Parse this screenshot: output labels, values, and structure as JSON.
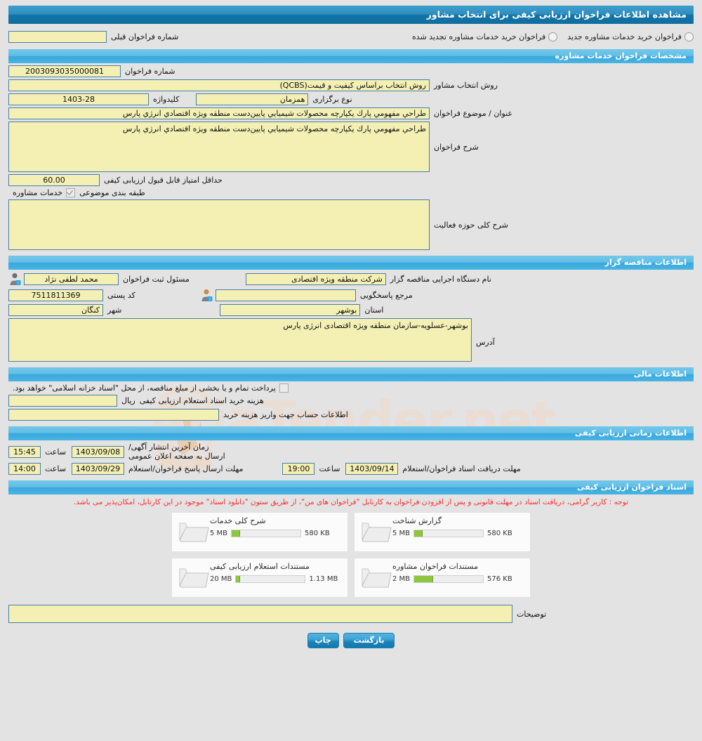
{
  "page": {
    "title": "مشاهده اطلاعات فراخوان ارزیابی کیفی برای انتخاب مشاور"
  },
  "top": {
    "radio_new": "فراخوان خرید خدمات مشاوره جدید",
    "radio_renewed": "فراخوان خرید خدمات مشاوره تجدید شده",
    "prev_call_label": "شماره فراخوان قبلی",
    "prev_call_value": ""
  },
  "sections": {
    "specs": "مشخصات فراخوان خدمات مشاوره",
    "organizer": "اطلاعات مناقصه گزار",
    "financial": "اطلاعات مالی",
    "timing": "اطلاعات زمانی ارزیابی کیفی",
    "documents": "اسناد فراخوان ارزیابی کیفی"
  },
  "specs": {
    "call_number_label": "شماره فراخوان",
    "call_number_value": "2003093035000081",
    "selection_method_label": "روش انتخاب مشاور",
    "selection_method_value": "روش انتخاب براساس کیفیت و قیمت(QCBS)",
    "holding_type_label": "نوع برگزاری",
    "holding_type_value": "همزمان",
    "keyword_label": "کلیدواژه",
    "keyword_value": "1403-28",
    "subject_label": "عنوان / موضوع فراخوان",
    "subject_value": "طراحي مفهومي پارك يكپارچه محصولات شيميايي پايین‌دست منطقه ویژه اقتصادي انرژي پارس",
    "description_label": "شرح فراخوان",
    "description_value": "طراحي مفهومي پارك يكپارچه محصولات شيميايي پايین‌دست منطقه ویژه اقتصادي انرژي پارس",
    "min_score_label": "حداقل امتیاز قابل قبول ارزیابی کیفی",
    "min_score_value": "60.00",
    "classification_label": "طبقه بندی موضوعی",
    "classification_value": "خدمات مشاوره",
    "classification_checked": true,
    "activity_scope_label": "شرح کلی حوزه فعالیت",
    "activity_scope_value": ""
  },
  "organizer": {
    "agency_label": "نام دستگاه اجرایی مناقصه گزار",
    "agency_value": "شرکت منطقه ویژه اقتصادی",
    "registrar_label": "مسئول ثبت فراخوان",
    "registrar_value": "محمد لطفی نژاد",
    "contact_label": "مرجع پاسخگویی",
    "contact_value": "",
    "postal_code_label": "کد پستی",
    "postal_code_value": "7511811369",
    "province_label": "استان",
    "province_value": "بوشهر",
    "city_label": "شهر",
    "city_value": "کنگان",
    "address_label": "آدرس",
    "address_value": "بوشهر-عسلویه-سازمان منطقه ویژه اقتصادی انرژی پارس"
  },
  "financial": {
    "treasury_note": "پرداخت تمام و یا بخشی از مبلغ مناقصه، از محل \"اسناد خزانه اسلامی\" خواهد بود.",
    "treasury_checked": false,
    "doc_cost_label": "هزینه خرید اسناد استعلام ارزیابی کیفی",
    "doc_cost_value": "",
    "currency_unit": "ریال",
    "account_info_label": "اطلاعات حساب جهت واریز هزینه خرید",
    "account_info_value": ""
  },
  "timing": {
    "publish_label": "زمان آخرین انتشار آگهی/ارسال به صفحه اعلان عمومی",
    "publish_date": "1403/09/08",
    "publish_time_label": "ساعت",
    "publish_time": "15:45",
    "receive_label": "مهلت دریافت اسناد فراخوان/استعلام",
    "receive_date": "1403/09/14",
    "receive_time_label": "ساعت",
    "receive_time": "19:00",
    "submit_label": "مهلت ارسال پاسخ فراخوان/استعلام",
    "submit_date": "1403/09/29",
    "submit_time_label": "ساعت",
    "submit_time": "14:00"
  },
  "documents": {
    "note": "توجه : کاربر گرامی، دریافت اسناد در مهلت قانونی و پس از افزودن فراخوان به کارتابل \"فراخوان های من\"، از طریق ستون \"دانلود اسناد\" موجود در این کارتابل، امکان‌پذیر می باشد.",
    "attachments": [
      {
        "title": "گزارش شناخت",
        "current_size": "580 KB",
        "max_size": "5 MB",
        "fill_percent": 12,
        "icon": "folder-icon"
      },
      {
        "title": "شرح کلی خدمات",
        "current_size": "580 KB",
        "max_size": "5 MB",
        "fill_percent": 12,
        "icon": "folder-icon"
      },
      {
        "title": "مستندات فراخوان مشاوره",
        "current_size": "576 KB",
        "max_size": "2 MB",
        "fill_percent": 28,
        "icon": "folder-icon"
      },
      {
        "title": "مستندات استعلام ارزیابی کیفی",
        "current_size": "1.13 MB",
        "max_size": "20 MB",
        "fill_percent": 6,
        "icon": "folder-icon"
      }
    ],
    "comments_label": "توضیحات",
    "comments_value": ""
  },
  "buttons": {
    "back": "بازگشت",
    "print": "چاپ"
  },
  "watermark": {
    "text": "AriaTender.net"
  },
  "colors": {
    "title_bar": "#1374a6",
    "section_bar": "#49b4e3",
    "field_bg": "#f4f0b4",
    "field_border": "#4a7fa5",
    "note_red": "#ff2a2a",
    "progress_green": "#8dc63f",
    "page_bg": "#e3e3e3"
  }
}
